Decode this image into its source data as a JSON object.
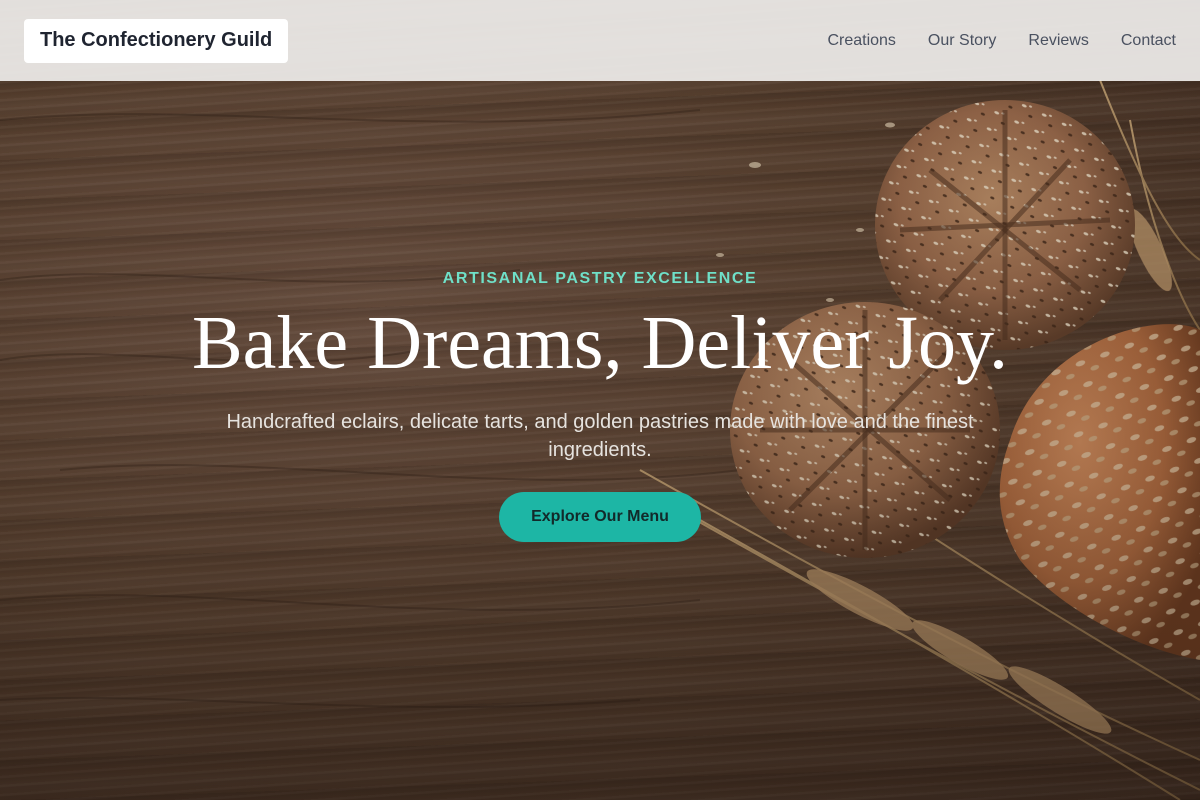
{
  "navbar": {
    "brand": "The Confectionery Guild",
    "links": [
      "Creations",
      "Our Story",
      "Reviews",
      "Contact"
    ]
  },
  "hero": {
    "eyebrow": "ARTISANAL PASTRY EXCELLENCE",
    "headline": "Bake Dreams, Deliver Joy.",
    "subhead": "Handcrafted eclairs, delicate tarts, and golden pastries made with love and the finest ingredients.",
    "cta_label": "Explore Our Menu",
    "background_image": "bread-loaves-and-wheat-on-wooden-table"
  },
  "colors": {
    "accent": "#1db6a5",
    "eyebrow": "#6fe0c8",
    "navbar_bg": "#eceae8",
    "headline": "#ffffff"
  }
}
